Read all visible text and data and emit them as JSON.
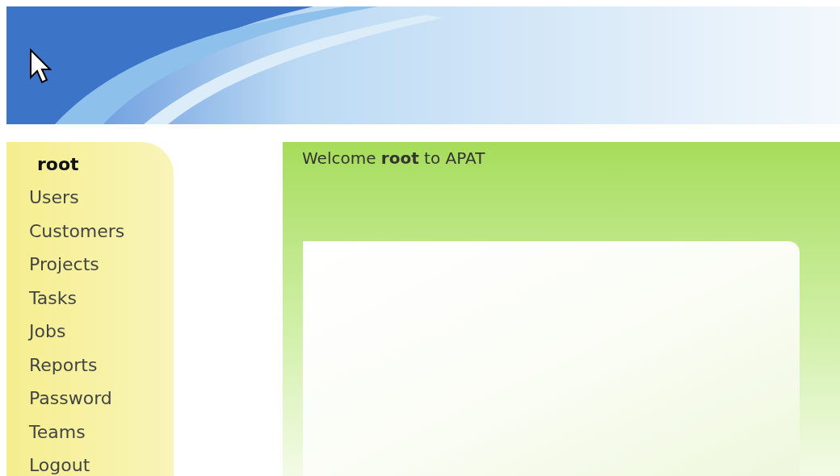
{
  "sidebar": {
    "user": "root",
    "items": [
      {
        "label": "Users"
      },
      {
        "label": "Customers"
      },
      {
        "label": "Projects"
      },
      {
        "label": "Tasks"
      },
      {
        "label": "Jobs"
      },
      {
        "label": "Reports"
      },
      {
        "label": "Password"
      },
      {
        "label": "Teams"
      },
      {
        "label": "Logout"
      }
    ]
  },
  "main": {
    "welcome": "Welcome **root** to APAT"
  }
}
